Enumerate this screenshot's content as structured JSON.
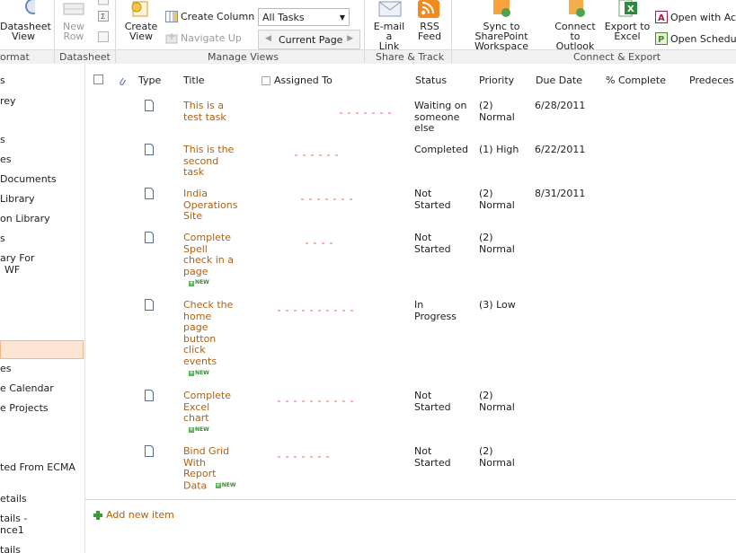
{
  "ribbon": {
    "groups": {
      "format": "ormat",
      "datasheet": "Datasheet",
      "manage_views": "Manage Views",
      "share_track": "Share & Track",
      "connect_export": "Connect & Export"
    },
    "datasheet_view": [
      "Datasheet",
      "View"
    ],
    "new_row": [
      "New",
      "Row"
    ],
    "create_view": [
      "Create",
      "View"
    ],
    "create_column": "Create Column",
    "navigate_up": "Navigate Up",
    "current_view": "All Tasks",
    "current_page": "Current Page",
    "email_link": [
      "E-mail a",
      "Link"
    ],
    "rss_feed": [
      "RSS",
      "Feed"
    ],
    "sync_workspace": [
      "Sync to SharePoint",
      "Workspace"
    ],
    "connect_outlook": [
      "Connect to",
      "Outlook"
    ],
    "export_excel": [
      "Export to",
      "Excel"
    ],
    "open_access": "Open with Ac",
    "open_schedule": "Open Schedu"
  },
  "leftnav": {
    "items": [
      {
        "label": "s"
      },
      {
        "label": "rey"
      },
      {
        "label": "s"
      },
      {
        "label": "es"
      },
      {
        "label": "Documents"
      },
      {
        "label": "Library"
      },
      {
        "label": "on Library"
      },
      {
        "label": "s"
      },
      {
        "label": "ary For"
      },
      {
        "label": "WF"
      },
      {
        "label": "es"
      },
      {
        "label": "e Calendar"
      },
      {
        "label": "e Projects"
      },
      {
        "label": "ted From ECMA"
      },
      {
        "label": "etails"
      },
      {
        "label": "tails -"
      },
      {
        "label": "nce1"
      },
      {
        "label": "tails"
      }
    ]
  },
  "list": {
    "columns": {
      "type": "Type",
      "title": "Title",
      "assigned_to": "Assigned To",
      "status": "Status",
      "priority": "Priority",
      "due_date": "Due Date",
      "complete": "% Complete",
      "predecessors": "Predeces"
    },
    "new_badge": "NEW",
    "rows": [
      {
        "title": [
          "This is a",
          "test task"
        ],
        "status": [
          "Waiting on",
          "someone",
          "else"
        ],
        "priority": [
          "(2)",
          "Normal"
        ],
        "due": "6/28/2011",
        "is_new": false
      },
      {
        "title": [
          "This is the",
          "second",
          "task"
        ],
        "status": [
          "Completed"
        ],
        "priority": [
          "(1) High"
        ],
        "due": "6/22/2011",
        "is_new": false
      },
      {
        "title": [
          "India",
          "Operations",
          "Site"
        ],
        "status": [
          "Not",
          "Started"
        ],
        "priority": [
          "(2)",
          "Normal"
        ],
        "due": "8/31/2011",
        "is_new": false
      },
      {
        "title": [
          "Complete",
          "Spell",
          "check in a",
          "page"
        ],
        "status": [
          "Not",
          "Started"
        ],
        "priority": [
          "(2)",
          "Normal"
        ],
        "due": "",
        "is_new": true
      },
      {
        "title": [
          "Check the",
          "home",
          "page",
          "button",
          "click",
          "events"
        ],
        "status": [
          "In",
          "Progress"
        ],
        "priority": [
          "(3) Low"
        ],
        "due": "",
        "is_new": true
      },
      {
        "title": [
          "Complete",
          "Excel",
          "chart"
        ],
        "status": [
          "Not",
          "Started"
        ],
        "priority": [
          "(2)",
          "Normal"
        ],
        "due": "",
        "is_new": true
      },
      {
        "title": [
          "Bind Grid",
          "With",
          "Report",
          "Data"
        ],
        "status": [
          "Not",
          "Started"
        ],
        "priority": [
          "(2)",
          "Normal"
        ],
        "due": "",
        "is_new": true
      }
    ],
    "add_new_item": "Add new item"
  },
  "colors": {
    "link_orange": "#b3600f",
    "selected_nav_bg": "#fde4d3",
    "new_green": "#2f8f2f"
  }
}
